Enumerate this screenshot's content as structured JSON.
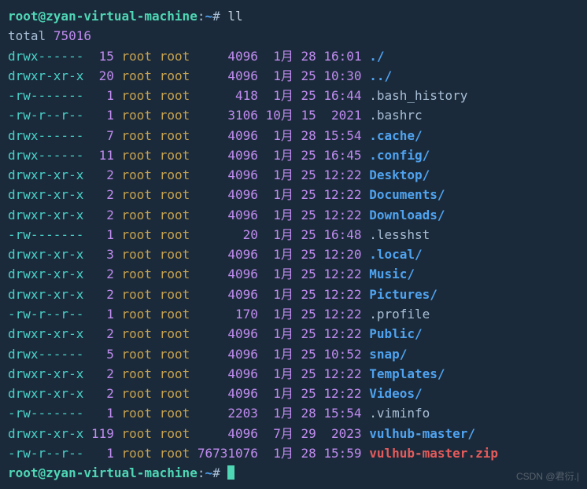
{
  "prompt": {
    "user_host": "root@zyan-virtual-machine",
    "colon": ":",
    "path": "~",
    "hash": "#",
    "command": "ll"
  },
  "total": {
    "label": "total",
    "value": "75016"
  },
  "rows": [
    {
      "perm": "drwx------",
      "links": "15",
      "owner": "root",
      "group": "root",
      "size": "4096",
      "month": "1月",
      "day": "28",
      "time": "16:01",
      "name": "./",
      "kind": "dir"
    },
    {
      "perm": "drwxr-xr-x",
      "links": "20",
      "owner": "root",
      "group": "root",
      "size": "4096",
      "month": "1月",
      "day": "25",
      "time": "10:30",
      "name": "../",
      "kind": "dir"
    },
    {
      "perm": "-rw-------",
      "links": "1",
      "owner": "root",
      "group": "root",
      "size": "418",
      "month": "1月",
      "day": "25",
      "time": "16:44",
      "name": ".bash_history",
      "kind": "plain"
    },
    {
      "perm": "-rw-r--r--",
      "links": "1",
      "owner": "root",
      "group": "root",
      "size": "3106",
      "month": "10月",
      "day": "15",
      "time": "2021",
      "name": ".bashrc",
      "kind": "plain"
    },
    {
      "perm": "drwx------",
      "links": "7",
      "owner": "root",
      "group": "root",
      "size": "4096",
      "month": "1月",
      "day": "28",
      "time": "15:54",
      "name": ".cache/",
      "kind": "dir"
    },
    {
      "perm": "drwx------",
      "links": "11",
      "owner": "root",
      "group": "root",
      "size": "4096",
      "month": "1月",
      "day": "25",
      "time": "16:45",
      "name": ".config/",
      "kind": "dir"
    },
    {
      "perm": "drwxr-xr-x",
      "links": "2",
      "owner": "root",
      "group": "root",
      "size": "4096",
      "month": "1月",
      "day": "25",
      "time": "12:22",
      "name": "Desktop/",
      "kind": "dir"
    },
    {
      "perm": "drwxr-xr-x",
      "links": "2",
      "owner": "root",
      "group": "root",
      "size": "4096",
      "month": "1月",
      "day": "25",
      "time": "12:22",
      "name": "Documents/",
      "kind": "dir"
    },
    {
      "perm": "drwxr-xr-x",
      "links": "2",
      "owner": "root",
      "group": "root",
      "size": "4096",
      "month": "1月",
      "day": "25",
      "time": "12:22",
      "name": "Downloads/",
      "kind": "dir"
    },
    {
      "perm": "-rw-------",
      "links": "1",
      "owner": "root",
      "group": "root",
      "size": "20",
      "month": "1月",
      "day": "25",
      "time": "16:48",
      "name": ".lesshst",
      "kind": "plain"
    },
    {
      "perm": "drwxr-xr-x",
      "links": "3",
      "owner": "root",
      "group": "root",
      "size": "4096",
      "month": "1月",
      "day": "25",
      "time": "12:20",
      "name": ".local/",
      "kind": "dir"
    },
    {
      "perm": "drwxr-xr-x",
      "links": "2",
      "owner": "root",
      "group": "root",
      "size": "4096",
      "month": "1月",
      "day": "25",
      "time": "12:22",
      "name": "Music/",
      "kind": "dir"
    },
    {
      "perm": "drwxr-xr-x",
      "links": "2",
      "owner": "root",
      "group": "root",
      "size": "4096",
      "month": "1月",
      "day": "25",
      "time": "12:22",
      "name": "Pictures/",
      "kind": "dir"
    },
    {
      "perm": "-rw-r--r--",
      "links": "1",
      "owner": "root",
      "group": "root",
      "size": "170",
      "month": "1月",
      "day": "25",
      "time": "12:22",
      "name": ".profile",
      "kind": "plain"
    },
    {
      "perm": "drwxr-xr-x",
      "links": "2",
      "owner": "root",
      "group": "root",
      "size": "4096",
      "month": "1月",
      "day": "25",
      "time": "12:22",
      "name": "Public/",
      "kind": "dir"
    },
    {
      "perm": "drwx------",
      "links": "5",
      "owner": "root",
      "group": "root",
      "size": "4096",
      "month": "1月",
      "day": "25",
      "time": "10:52",
      "name": "snap/",
      "kind": "dir"
    },
    {
      "perm": "drwxr-xr-x",
      "links": "2",
      "owner": "root",
      "group": "root",
      "size": "4096",
      "month": "1月",
      "day": "25",
      "time": "12:22",
      "name": "Templates/",
      "kind": "dir"
    },
    {
      "perm": "drwxr-xr-x",
      "links": "2",
      "owner": "root",
      "group": "root",
      "size": "4096",
      "month": "1月",
      "day": "25",
      "time": "12:22",
      "name": "Videos/",
      "kind": "dir"
    },
    {
      "perm": "-rw-------",
      "links": "1",
      "owner": "root",
      "group": "root",
      "size": "2203",
      "month": "1月",
      "day": "28",
      "time": "15:54",
      "name": ".viminfo",
      "kind": "plain"
    },
    {
      "perm": "drwxr-xr-x",
      "links": "119",
      "owner": "root",
      "group": "root",
      "size": "4096",
      "month": "7月",
      "day": "29",
      "time": "2023",
      "name": "vulhub-master/",
      "kind": "dir"
    },
    {
      "perm": "-rw-r--r--",
      "links": "1",
      "owner": "root",
      "group": "root",
      "size": "76731076",
      "month": "1月",
      "day": "28",
      "time": "15:59",
      "name": "vulhub-master.zip",
      "kind": "archive"
    }
  ],
  "watermark": "CSDN @君衍.|"
}
